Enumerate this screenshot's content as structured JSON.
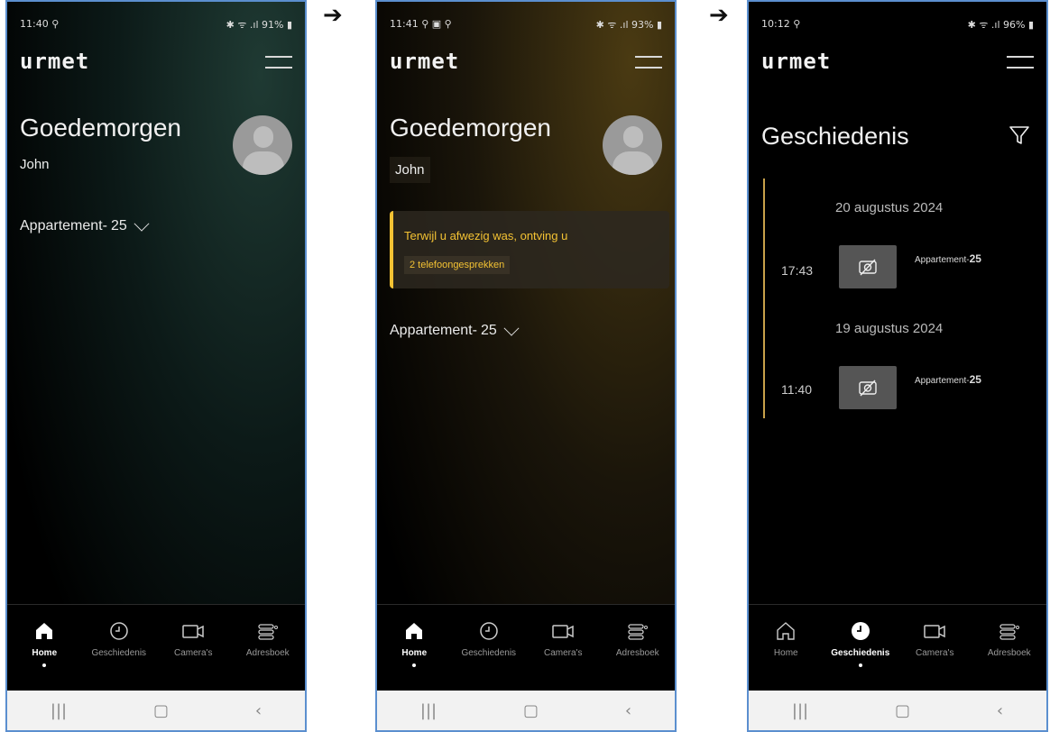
{
  "arrows": [
    "➔",
    "➔"
  ],
  "screens": [
    {
      "status": {
        "time": "11:40 ⚲",
        "right": "✱ ᯤ .ıl 91% ▮"
      },
      "logo": "urmet",
      "greeting": "Goedemorgen",
      "user": "John",
      "apartment": {
        "label": "Appartement-",
        "number": "25"
      },
      "nav": [
        {
          "label": "Home",
          "icon": "home-icon"
        },
        {
          "label": "Geschiedenis",
          "icon": "clock-icon"
        },
        {
          "label": "Camera's",
          "icon": "camera-icon"
        },
        {
          "label": "Adresboek",
          "icon": "addressbook-icon"
        }
      ],
      "sysnav": [
        "|||",
        "▢",
        "‹"
      ]
    },
    {
      "status": {
        "time": "11:41 ⚲ ▣ ⚲",
        "right": "✱ ᯤ .ıl 93% ▮"
      },
      "logo": "urmet",
      "greeting": "Goedemorgen",
      "user": "John",
      "notice": {
        "text": "Terwijl u afwezig was, ontving u",
        "detail": "2 telefoongesprekken"
      },
      "apartment": {
        "label": "Appartement-",
        "number": "25"
      },
      "nav": [
        {
          "label": "Home",
          "icon": "home-icon"
        },
        {
          "label": "Geschiedenis",
          "icon": "clock-icon"
        },
        {
          "label": "Camera's",
          "icon": "camera-icon"
        },
        {
          "label": "Adresboek",
          "icon": "addressbook-icon"
        }
      ],
      "sysnav": [
        "|||",
        "▢",
        "‹"
      ]
    },
    {
      "status": {
        "time": "10:12 ⚲",
        "right": "✱ ᯤ .ıl 96% ▮"
      },
      "logo": "urmet",
      "title": "Geschiedenis",
      "entries": [
        {
          "date": "20 augustus 2024",
          "time": "17:43",
          "apt_label": "Appartement-",
          "apt_number": "25"
        },
        {
          "date": "19 augustus 2024",
          "time": "11:40",
          "apt_label": "Appartement-",
          "apt_number": "25"
        }
      ],
      "nav": [
        {
          "label": "Home",
          "icon": "home-icon"
        },
        {
          "label": "Geschiedenis",
          "icon": "clock-icon"
        },
        {
          "label": "Camera's",
          "icon": "camera-icon"
        },
        {
          "label": "Adresboek",
          "icon": "addressbook-icon"
        }
      ],
      "sysnav": [
        "|||",
        "▢",
        "‹"
      ]
    }
  ],
  "colors": {
    "accent": "#f3c233",
    "frame": "#5b8fcf",
    "timeline": "#c8a14a"
  }
}
